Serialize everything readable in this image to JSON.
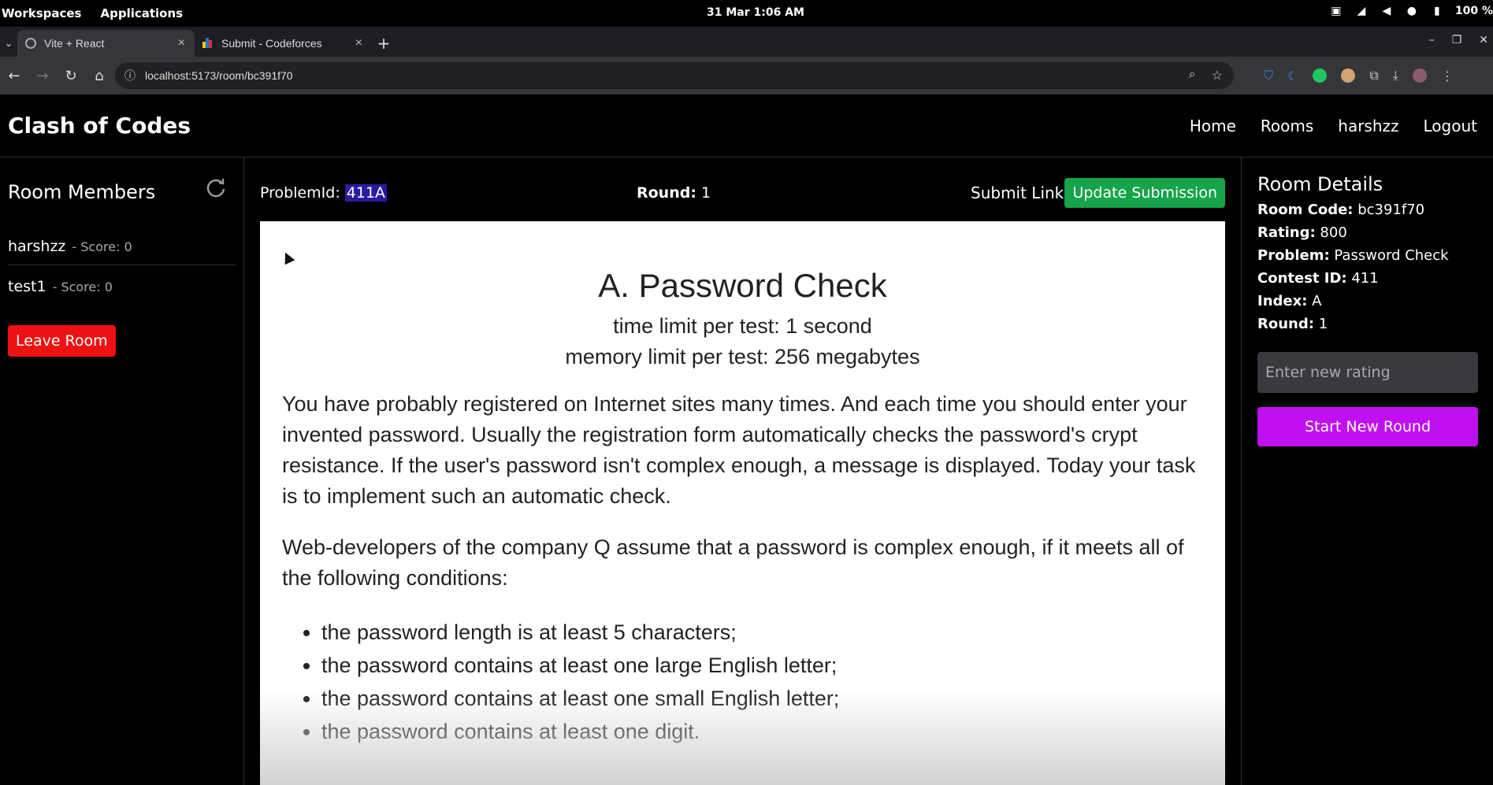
{
  "os": {
    "workspaces": "Workspaces",
    "applications": "Applications",
    "clock": "31 Mar  1:06 AM",
    "battery": "100 %"
  },
  "browser": {
    "tabs": [
      {
        "title": "Vite + React",
        "active": true
      },
      {
        "title": "Submit - Codeforces",
        "active": false
      }
    ],
    "url": "localhost:5173/room/bc391f70"
  },
  "app": {
    "brand": "Clash of Codes",
    "nav": [
      "Home",
      "Rooms",
      "harshzz",
      "Logout"
    ]
  },
  "members": {
    "title": "Room Members",
    "list": [
      {
        "name": "harshzz",
        "score": "- Score: 0"
      },
      {
        "name": "test1",
        "score": "- Score: 0"
      }
    ],
    "leave_label": "Leave Room"
  },
  "header": {
    "problem_id_label": "ProblemId:",
    "problem_id": "411A",
    "round_label": "Round:",
    "round": "1",
    "submit_link": "Submit Link",
    "update_label": "Update Submission"
  },
  "problem": {
    "title": "A. Password Check",
    "time_limit": "time limit per test: 1 second",
    "memory_limit": "memory limit per test: 256 megabytes",
    "paragraphs": [
      "You have probably registered on Internet sites many times. And each time you should enter your invented password. Usually the registration form automatically checks the password's crypt resistance. If the user's password isn't complex enough, a message is displayed. Today your task is to implement such an automatic check.",
      "Web-developers of the company Q assume that a password is complex enough, if it meets all of the following conditions:"
    ],
    "conditions": [
      "the password length is at least 5 characters;",
      "the password contains at least one large English letter;",
      "the password contains at least one small English letter;",
      "the password contains at least one digit."
    ]
  },
  "details": {
    "title": "Room Details",
    "rows": [
      {
        "label": "Room Code:",
        "value": "bc391f70"
      },
      {
        "label": "Rating:",
        "value": "800"
      },
      {
        "label": "Problem:",
        "value": "Password Check"
      },
      {
        "label": "Contest ID:",
        "value": "411"
      },
      {
        "label": "Index:",
        "value": "A"
      },
      {
        "label": "Round:",
        "value": "1"
      }
    ],
    "rating_placeholder": "Enter new rating",
    "start_label": "Start New Round"
  },
  "colors": {
    "update_button": "#16a34a",
    "leave_button": "#e11111",
    "start_button": "#c00ff0",
    "selection": "#2c1a9e"
  }
}
